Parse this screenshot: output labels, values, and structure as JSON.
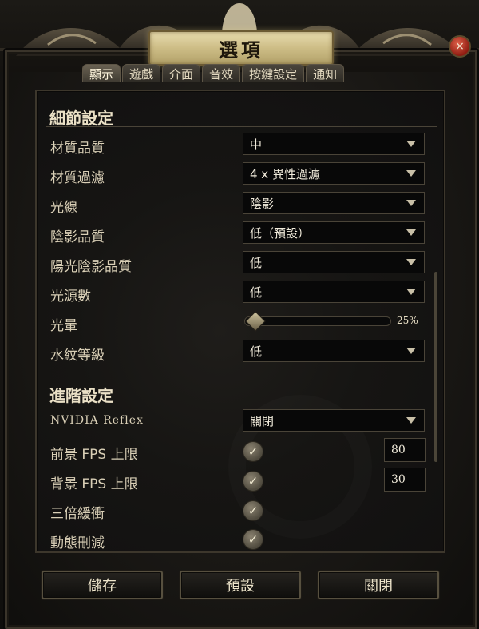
{
  "window": {
    "title": "選項",
    "close_icon": "×"
  },
  "tabs": [
    {
      "label": "顯示",
      "active": true
    },
    {
      "label": "遊戲"
    },
    {
      "label": "介面"
    },
    {
      "label": "音效"
    },
    {
      "label": "按鍵設定"
    },
    {
      "label": "通知"
    }
  ],
  "detail_section": {
    "title": "細節設定",
    "texture_quality": {
      "label": "材質品質",
      "value": "中"
    },
    "texture_filtering": {
      "label": "材質過濾",
      "value": "4 x 異性過濾"
    },
    "ray_tracing": {
      "label": "光線",
      "value": "陰影"
    },
    "shadow_quality": {
      "label": "陰影品質",
      "value": "低（預設）"
    },
    "sun_shadow_quality": {
      "label": "陽光陰影品質",
      "value": "低"
    },
    "light_sources": {
      "label": "光源數",
      "value": "低"
    },
    "bloom": {
      "label": "光暈",
      "value_text": "25%",
      "value": 0.25
    },
    "water_detail": {
      "label": "水紋等級",
      "value": "低"
    }
  },
  "advanced_section": {
    "title": "進階設定",
    "nvidia_reflex": {
      "label": "NVIDIA Reflex",
      "value": "關閉"
    },
    "foreground_fps": {
      "label": "前景 FPS 上限",
      "checked": true,
      "value": "80"
    },
    "background_fps": {
      "label": "背景 FPS 上限",
      "checked": true,
      "value": "30"
    },
    "triple_buffering": {
      "label": "三倍緩衝",
      "checked": true
    },
    "dynamic_culling": {
      "label": "動態刪減",
      "checked": true
    }
  },
  "checkmark_icon": "✓",
  "footer": {
    "save": "儲存",
    "defaults": "預設",
    "close": "關閉"
  },
  "colors": {
    "accent_gold": "#cdbd86",
    "close_red": "#b22a19",
    "panel_bg": "#151412"
  }
}
